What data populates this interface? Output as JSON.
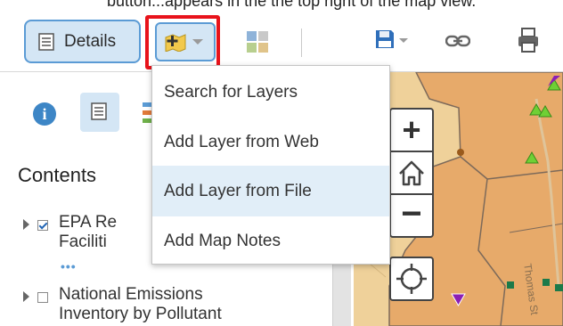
{
  "top_cut_text": "button...appears in the the top right of the map view.",
  "toolbar": {
    "details_label": "Details",
    "details_icon": "details-list-icon",
    "add_icon": "add-layer-icon",
    "basemap_icon": "basemap-grid-icon",
    "save_icon": "save-icon",
    "share_icon": "link-icon",
    "print_icon": "print-icon"
  },
  "add_menu": {
    "items": [
      {
        "label": "Search for Layers",
        "highlighted": false
      },
      {
        "label": "Add Layer from Web",
        "highlighted": false
      },
      {
        "label": "Add Layer from File",
        "highlighted": true
      },
      {
        "label": "Add Map Notes",
        "highlighted": false
      }
    ]
  },
  "sidebar": {
    "tabs": [
      {
        "icon": "info-icon",
        "active": false
      },
      {
        "icon": "contents-list-icon",
        "active": true
      },
      {
        "icon": "legend-icon",
        "active": false
      }
    ],
    "contents_heading": "Contents",
    "layers": [
      {
        "name_lines": [
          "EPA Re",
          "Faciliti"
        ],
        "checked": true,
        "has_more": true,
        "more": "•••"
      },
      {
        "name_lines": [
          "National Emissions",
          "Inventory by Pollutant"
        ],
        "checked": false,
        "has_more": false
      }
    ]
  },
  "map": {
    "controls": [
      "zoom-in",
      "home",
      "zoom-out",
      "locate"
    ],
    "zoom_in_symbol": "+",
    "zoom_out_symbol": "−",
    "street_label": "Thomas St",
    "colors": {
      "base": "#efd19a",
      "district": "#e7aa6a",
      "marker_triangle": "#6fd035",
      "marker_invert": "#8b1fb5"
    }
  },
  "colors": {
    "highlight_red": "#e8131b",
    "button_active_bg": "#d4e6f5",
    "button_border": "#5b9bd5",
    "menu_highlight": "#e1eef8"
  }
}
